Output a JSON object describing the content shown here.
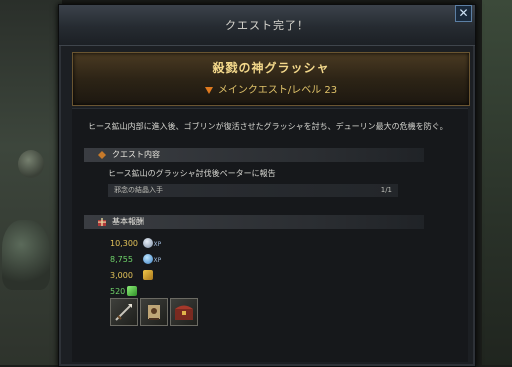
{
  "window": {
    "title": "クエスト完了！",
    "close_label": "✕"
  },
  "banner": {
    "quest_name": "殺戮の神グラッシャ",
    "quest_type": "メインクエスト/レベル 23"
  },
  "description": "ヒース鉱山内部に進入後、ゴブリンが復活させたグラッシャを討ち、デューリン最大の危機を防ぐ。",
  "quest_content": {
    "header": "クエスト内容",
    "detail": "ヒース鉱山のグラッシャ討伐後ペーターに報告",
    "objective": {
      "label": "邪念の結晶入手",
      "count": "1/1"
    }
  },
  "rewards": {
    "header": "基本報酬",
    "xp": "10,300",
    "xp_tag": "XP",
    "soul_xp": "8,755",
    "soul_xp_tag": "XP",
    "gold": "3,000",
    "gem": "520",
    "items": [
      {
        "icon": "spear-item-icon"
      },
      {
        "icon": "scroll-item-icon"
      },
      {
        "icon": "chest-item-icon"
      }
    ]
  },
  "colors": {
    "accent_gold": "#e4c45a",
    "accent_green": "#6fd36a",
    "banner_text": "#f3d88b"
  }
}
